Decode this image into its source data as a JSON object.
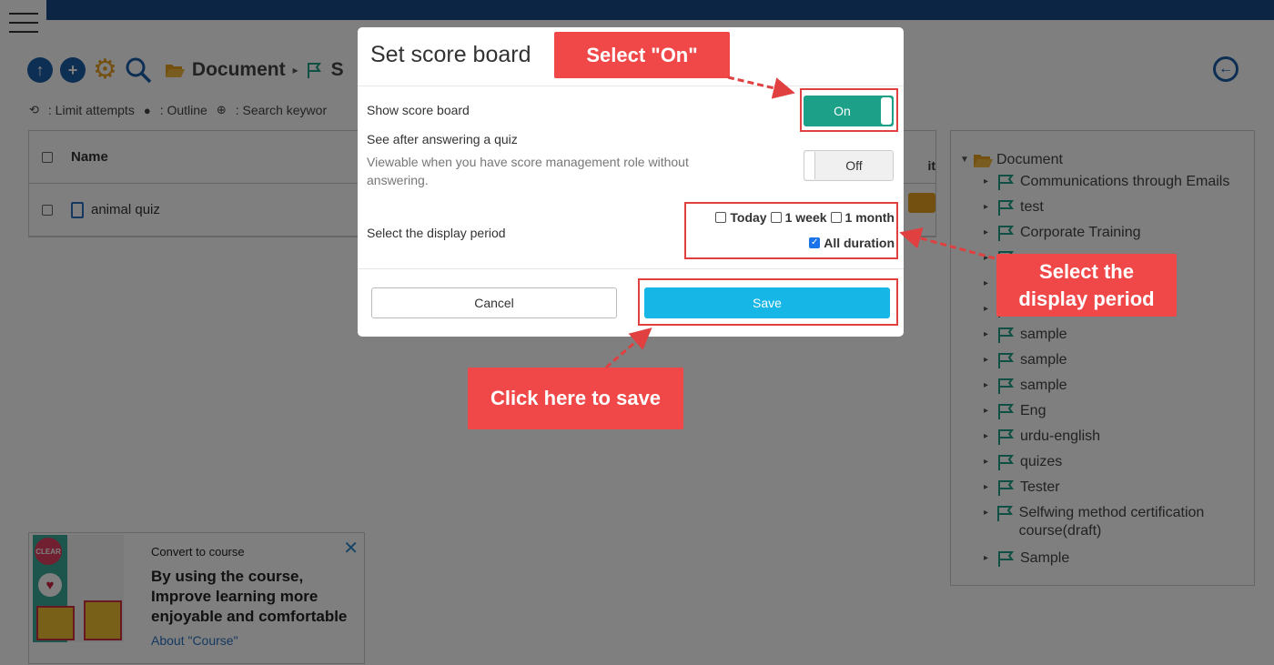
{
  "breadcrumb": {
    "root": "Document",
    "current": "S"
  },
  "legend": [
    {
      "icon": "loop-icon",
      "text": ": Limit attempts"
    },
    {
      "icon": "speech-icon",
      "text": ": Outline"
    },
    {
      "icon": "zoom-icon",
      "text": ": Search keywor"
    }
  ],
  "table": {
    "header_name": "Name",
    "header_right": "it",
    "rows": [
      {
        "name": "animal quiz"
      }
    ]
  },
  "tree": {
    "root": "Document",
    "items": [
      "Communications through Emails",
      "test",
      "Corporate Training",
      "",
      "",
      "",
      "sample",
      "sample",
      "sample",
      "Eng",
      "urdu-english",
      "quizes",
      "Tester",
      "Selfwing method certification course(draft)",
      "Sample"
    ]
  },
  "promo": {
    "subtitle": "Convert to course",
    "title": "By using the course, Improve learning more enjoyable and comfortable",
    "link": "About \"Course\"",
    "close": "✕"
  },
  "modal": {
    "title": "Set score board",
    "show_label": "Show score board",
    "show_toggle": "On",
    "see_after_label": "See after answering a quiz",
    "see_after_note": "Viewable when you have score management role without answering.",
    "see_after_toggle": "Off",
    "period_label": "Select the display period",
    "period_options": [
      {
        "label": "Today",
        "checked": false
      },
      {
        "label": "1 week",
        "checked": false
      },
      {
        "label": "1 month",
        "checked": false
      },
      {
        "label": "All duration",
        "checked": true
      }
    ],
    "cancel": "Cancel",
    "save": "Save"
  },
  "callouts": {
    "select_on": "Select \"On\"",
    "select_period": "Select the display period",
    "click_save": "Click here to save"
  },
  "colors": {
    "accent": "#1a5fa8",
    "toggle_on": "#1ca087",
    "save": "#16b6e6",
    "callout": "#f04848"
  }
}
